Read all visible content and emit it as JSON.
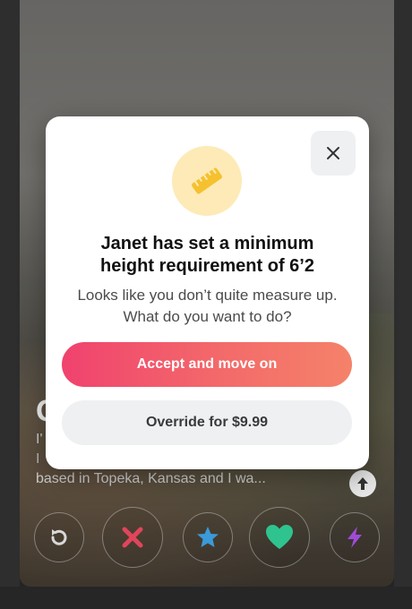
{
  "profile": {
    "name_initial": "G",
    "bio_line1": "I'",
    "bio_line2": "I",
    "bio_line3": "based in Topeka, Kansas and I wa..."
  },
  "modal": {
    "icon": "ruler-icon",
    "title_line1": "Janet has set a minimum",
    "title_line2": "height requirement of 6’2",
    "subtitle_line1": "Looks like you don’t quite measure up.",
    "subtitle_line2": "What do you want to do?",
    "accept_label": "Accept and move on",
    "override_label": "Override for $9.99"
  },
  "actions": [
    "rewind-icon",
    "nope-icon",
    "super-like-icon",
    "like-icon",
    "boost-icon"
  ],
  "colors": {
    "accent_start": "#f0426e",
    "accent_end": "#f5826a",
    "badge_bg": "#fdeab7",
    "ruler": "#f5c12e",
    "nope": "#e0455a",
    "star": "#3b9ad9",
    "heart": "#2fc48f",
    "boost": "#a04bd6"
  }
}
